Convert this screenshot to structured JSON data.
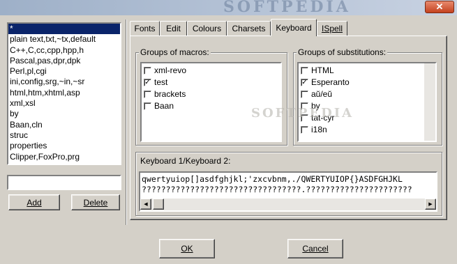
{
  "window": {
    "watermark": "SOFTPEDIA",
    "close_label": "✕"
  },
  "left_panel": {
    "items": [
      "*",
      "plain text,txt,~tx,default",
      "C++,C,cc,cpp,hpp,h",
      "Pascal,pas,dpr,dpk",
      "Perl,pl,cgi",
      "ini,config,srg,~in,~sr",
      "html,htm,xhtml,asp",
      "xml,xsl",
      "by",
      "Baan,cln",
      "struc",
      "properties",
      "Clipper,FoxPro,prg"
    ],
    "selected_index": 0,
    "input_value": "",
    "add_label": "Add",
    "delete_label": "Delete"
  },
  "tabs": [
    "Fonts",
    "Edit",
    "Colours",
    "Charsets",
    "Keyboard",
    "ISpell"
  ],
  "active_tab": "Keyboard",
  "macros": {
    "title": "Groups of macros:",
    "items": [
      {
        "label": "xml-revo",
        "checked": false
      },
      {
        "label": "test",
        "checked": true
      },
      {
        "label": "brackets",
        "checked": false
      },
      {
        "label": "Baan",
        "checked": false
      }
    ]
  },
  "substitutions": {
    "title": "Groups of substitutions:",
    "items": [
      {
        "label": "HTML",
        "checked": false
      },
      {
        "label": "Esperanto",
        "checked": true
      },
      {
        "label": "aŭ/eŭ",
        "checked": false
      },
      {
        "label": "by",
        "checked": false
      },
      {
        "label": "tat-cyr",
        "checked": false
      },
      {
        "label": "i18n",
        "checked": false
      }
    ]
  },
  "keyboard": {
    "title": "Keyboard 1/Keyboard 2:",
    "line1": "qwertyuiop[]asdfghjkl;'zxcvbnm,./QWERTYUIOP{}ASDFGHJKL",
    "line2": "?????????????????????????????????.??????????????????????"
  },
  "watermark_center": "SOFTPEDIA",
  "footer": {
    "ok_label": "OK",
    "cancel_label": "Cancel"
  }
}
